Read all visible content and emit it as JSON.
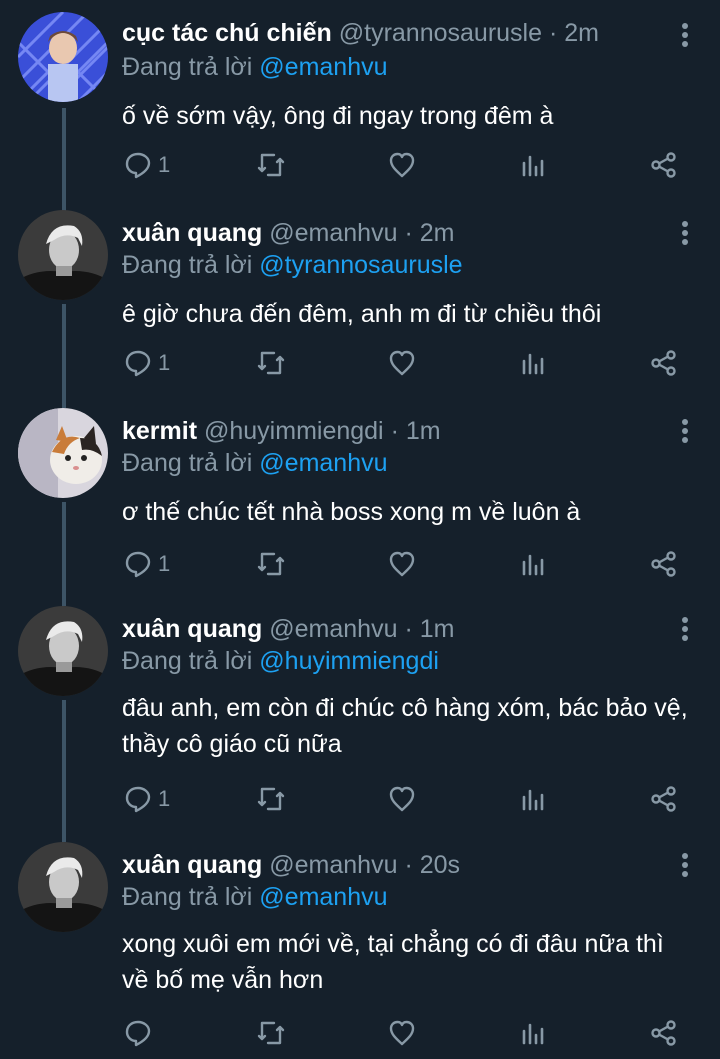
{
  "reply_prefix": "Đang trả lời",
  "colors": {
    "background": "#15202b",
    "muted": "#8899a6",
    "link": "#1da1f2",
    "thread_line": "#3d5466"
  },
  "tweets": [
    {
      "name": "cục tác chú chiến",
      "handle": "@tyrannosaurusle",
      "dot": "·",
      "time": "2m",
      "reply_to": "@emanhvu",
      "text": "ố về sớm vậy, ông đi ngay trong đêm à",
      "reply_count": "1",
      "avatar": "user-avatar-blue-pattern"
    },
    {
      "name": "xuân quang",
      "handle": "@emanhvu",
      "dot": "·",
      "time": "2m",
      "reply_to": "@tyrannosaurusle",
      "text": "ê giờ chưa đến đêm, anh m đi từ chiều thôi",
      "reply_count": "1",
      "avatar": "user-avatar-bw-portrait"
    },
    {
      "name": "kermit",
      "handle": "@huyimmiengdi",
      "dot": "·",
      "time": "1m",
      "reply_to": "@emanhvu",
      "text": "ơ thế chúc tết nhà boss xong m về luôn à",
      "reply_count": "1",
      "avatar": "user-avatar-cat"
    },
    {
      "name": "xuân quang",
      "handle": "@emanhvu",
      "dot": "·",
      "time": "1m",
      "reply_to": "@huyimmiengdi",
      "text": "đâu anh, em còn đi chúc cô hàng xóm, bác bảo vệ, thầy cô giáo cũ nữa",
      "reply_count": "1",
      "avatar": "user-avatar-bw-portrait"
    },
    {
      "name": "xuân quang",
      "handle": "@emanhvu",
      "dot": "·",
      "time": "20s",
      "reply_to": "@emanhvu",
      "text": "xong xuôi em mới về, tại chẳng có đi đâu nữa thì về bố mẹ vẫn hơn",
      "reply_count": "",
      "avatar": "user-avatar-bw-portrait"
    }
  ]
}
